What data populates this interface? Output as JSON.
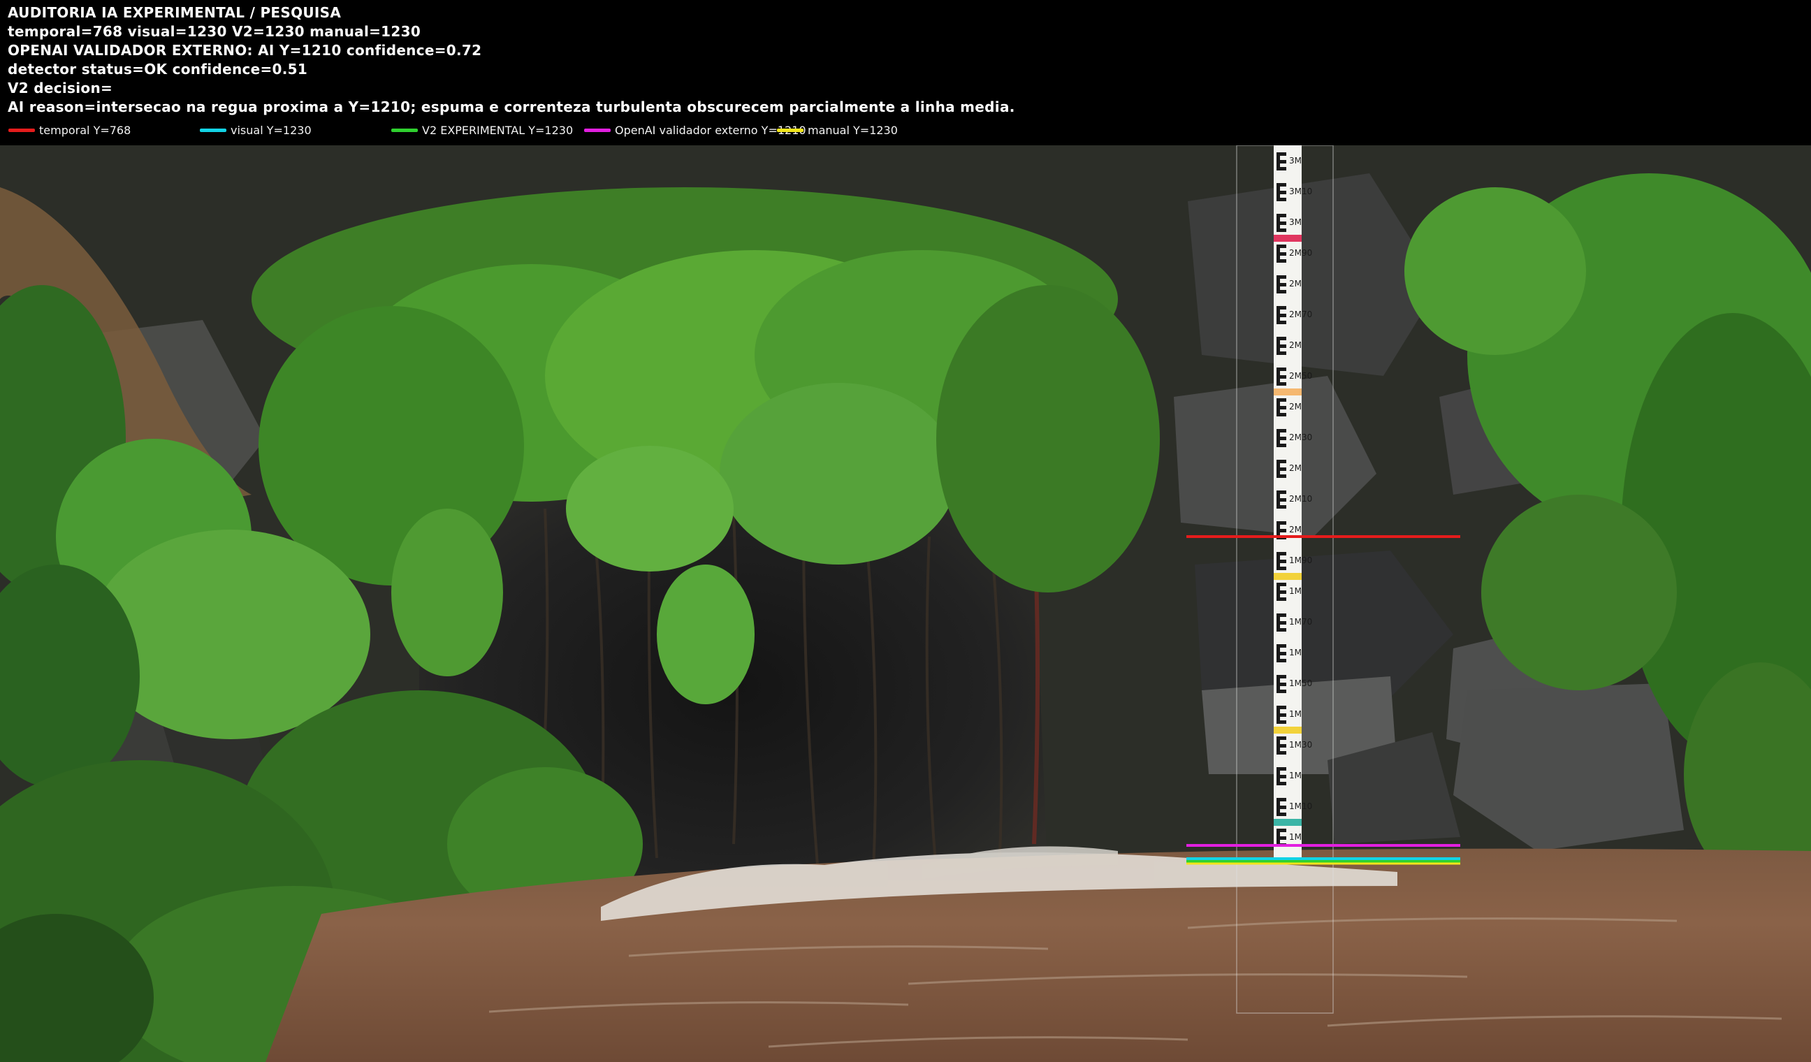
{
  "header": {
    "title": "AUDITORIA IA  EXPERIMENTAL / PESQUISA",
    "readings": "temporal=768  visual=1230  V2=1230  manual=1230",
    "openai": "OPENAI  VALIDADOR EXTERNO: AI Y=1210  confidence=0.72",
    "detector": "detector status=OK confidence=0.51",
    "decision": "V2 decision=",
    "reason": "AI reason=intersecao na regua proxima a Y=1210; espuma e correnteza turbulenta obscurecem parcialmente a linha media."
  },
  "legend": [
    {
      "label": "temporal Y=768",
      "color": "#e51c1c"
    },
    {
      "label": "visual Y=1230",
      "color": "#12d4e6"
    },
    {
      "label": "V2 EXPERIMENTAL Y=1230",
      "color": "#2fd12f"
    },
    {
      "label": "OpenAI validador externo Y=1210",
      "color": "#e21fe0"
    },
    {
      "label": "manual Y=1230",
      "color": "#f2e51a"
    }
  ],
  "measurements": {
    "temporal": 768,
    "visual": 1230,
    "v2": 1230,
    "openai": 1210,
    "manual": 1230
  },
  "gauge": {
    "labels": [
      "3M",
      "3M10",
      "3M",
      "2M90",
      "2M",
      "2M70",
      "2M",
      "2M50",
      "2M",
      "2M30",
      "2M",
      "2M10",
      "2M",
      "1M90",
      "1M",
      "1M70",
      "1M",
      "1M50",
      "1M",
      "1M30",
      "1M",
      "1M10",
      "1M"
    ]
  }
}
